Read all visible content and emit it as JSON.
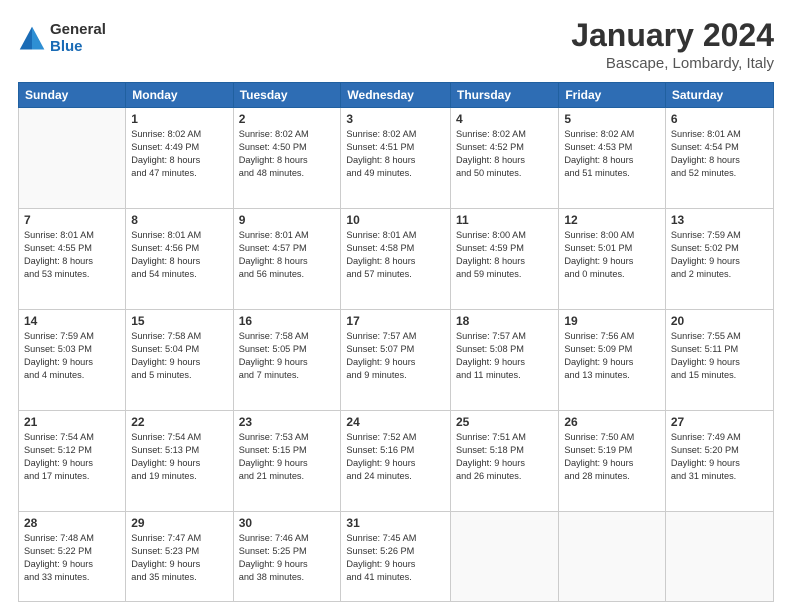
{
  "logo": {
    "general": "General",
    "blue": "Blue"
  },
  "header": {
    "title": "January 2024",
    "subtitle": "Bascape, Lombardy, Italy"
  },
  "weekdays": [
    "Sunday",
    "Monday",
    "Tuesday",
    "Wednesday",
    "Thursday",
    "Friday",
    "Saturday"
  ],
  "weeks": [
    [
      {
        "day": "",
        "info": ""
      },
      {
        "day": "1",
        "info": "Sunrise: 8:02 AM\nSunset: 4:49 PM\nDaylight: 8 hours\nand 47 minutes."
      },
      {
        "day": "2",
        "info": "Sunrise: 8:02 AM\nSunset: 4:50 PM\nDaylight: 8 hours\nand 48 minutes."
      },
      {
        "day": "3",
        "info": "Sunrise: 8:02 AM\nSunset: 4:51 PM\nDaylight: 8 hours\nand 49 minutes."
      },
      {
        "day": "4",
        "info": "Sunrise: 8:02 AM\nSunset: 4:52 PM\nDaylight: 8 hours\nand 50 minutes."
      },
      {
        "day": "5",
        "info": "Sunrise: 8:02 AM\nSunset: 4:53 PM\nDaylight: 8 hours\nand 51 minutes."
      },
      {
        "day": "6",
        "info": "Sunrise: 8:01 AM\nSunset: 4:54 PM\nDaylight: 8 hours\nand 52 minutes."
      }
    ],
    [
      {
        "day": "7",
        "info": "Sunrise: 8:01 AM\nSunset: 4:55 PM\nDaylight: 8 hours\nand 53 minutes."
      },
      {
        "day": "8",
        "info": "Sunrise: 8:01 AM\nSunset: 4:56 PM\nDaylight: 8 hours\nand 54 minutes."
      },
      {
        "day": "9",
        "info": "Sunrise: 8:01 AM\nSunset: 4:57 PM\nDaylight: 8 hours\nand 56 minutes."
      },
      {
        "day": "10",
        "info": "Sunrise: 8:01 AM\nSunset: 4:58 PM\nDaylight: 8 hours\nand 57 minutes."
      },
      {
        "day": "11",
        "info": "Sunrise: 8:00 AM\nSunset: 4:59 PM\nDaylight: 8 hours\nand 59 minutes."
      },
      {
        "day": "12",
        "info": "Sunrise: 8:00 AM\nSunset: 5:01 PM\nDaylight: 9 hours\nand 0 minutes."
      },
      {
        "day": "13",
        "info": "Sunrise: 7:59 AM\nSunset: 5:02 PM\nDaylight: 9 hours\nand 2 minutes."
      }
    ],
    [
      {
        "day": "14",
        "info": "Sunrise: 7:59 AM\nSunset: 5:03 PM\nDaylight: 9 hours\nand 4 minutes."
      },
      {
        "day": "15",
        "info": "Sunrise: 7:58 AM\nSunset: 5:04 PM\nDaylight: 9 hours\nand 5 minutes."
      },
      {
        "day": "16",
        "info": "Sunrise: 7:58 AM\nSunset: 5:05 PM\nDaylight: 9 hours\nand 7 minutes."
      },
      {
        "day": "17",
        "info": "Sunrise: 7:57 AM\nSunset: 5:07 PM\nDaylight: 9 hours\nand 9 minutes."
      },
      {
        "day": "18",
        "info": "Sunrise: 7:57 AM\nSunset: 5:08 PM\nDaylight: 9 hours\nand 11 minutes."
      },
      {
        "day": "19",
        "info": "Sunrise: 7:56 AM\nSunset: 5:09 PM\nDaylight: 9 hours\nand 13 minutes."
      },
      {
        "day": "20",
        "info": "Sunrise: 7:55 AM\nSunset: 5:11 PM\nDaylight: 9 hours\nand 15 minutes."
      }
    ],
    [
      {
        "day": "21",
        "info": "Sunrise: 7:54 AM\nSunset: 5:12 PM\nDaylight: 9 hours\nand 17 minutes."
      },
      {
        "day": "22",
        "info": "Sunrise: 7:54 AM\nSunset: 5:13 PM\nDaylight: 9 hours\nand 19 minutes."
      },
      {
        "day": "23",
        "info": "Sunrise: 7:53 AM\nSunset: 5:15 PM\nDaylight: 9 hours\nand 21 minutes."
      },
      {
        "day": "24",
        "info": "Sunrise: 7:52 AM\nSunset: 5:16 PM\nDaylight: 9 hours\nand 24 minutes."
      },
      {
        "day": "25",
        "info": "Sunrise: 7:51 AM\nSunset: 5:18 PM\nDaylight: 9 hours\nand 26 minutes."
      },
      {
        "day": "26",
        "info": "Sunrise: 7:50 AM\nSunset: 5:19 PM\nDaylight: 9 hours\nand 28 minutes."
      },
      {
        "day": "27",
        "info": "Sunrise: 7:49 AM\nSunset: 5:20 PM\nDaylight: 9 hours\nand 31 minutes."
      }
    ],
    [
      {
        "day": "28",
        "info": "Sunrise: 7:48 AM\nSunset: 5:22 PM\nDaylight: 9 hours\nand 33 minutes."
      },
      {
        "day": "29",
        "info": "Sunrise: 7:47 AM\nSunset: 5:23 PM\nDaylight: 9 hours\nand 35 minutes."
      },
      {
        "day": "30",
        "info": "Sunrise: 7:46 AM\nSunset: 5:25 PM\nDaylight: 9 hours\nand 38 minutes."
      },
      {
        "day": "31",
        "info": "Sunrise: 7:45 AM\nSunset: 5:26 PM\nDaylight: 9 hours\nand 41 minutes."
      },
      {
        "day": "",
        "info": ""
      },
      {
        "day": "",
        "info": ""
      },
      {
        "day": "",
        "info": ""
      }
    ]
  ]
}
